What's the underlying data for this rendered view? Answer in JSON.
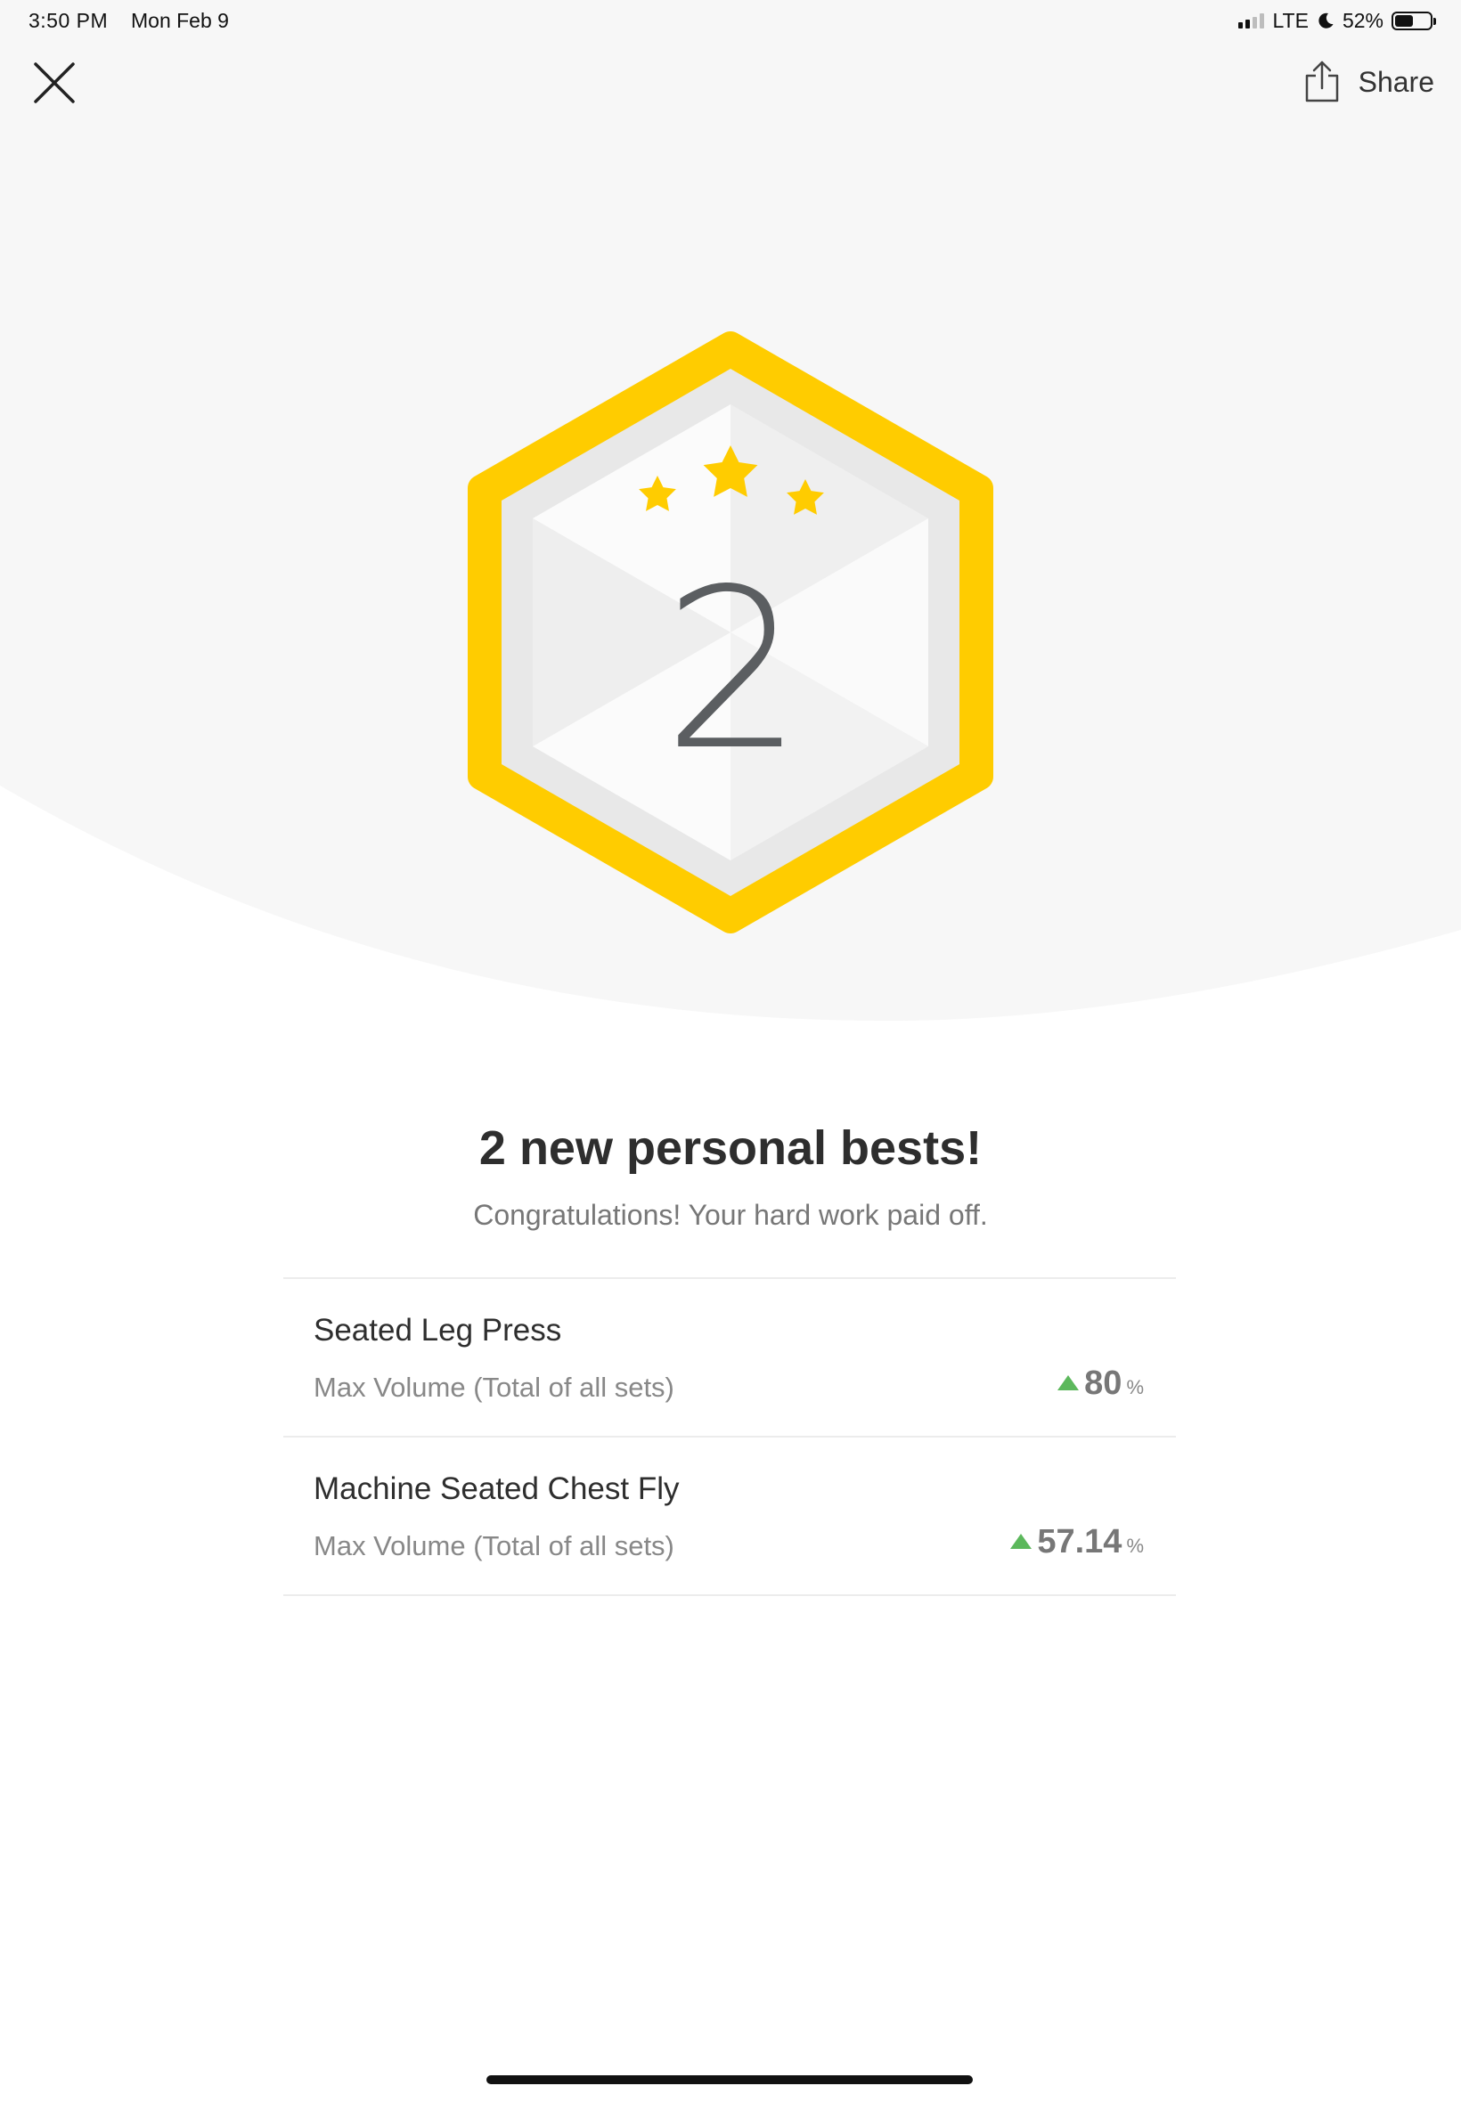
{
  "status_bar": {
    "time": "3:50 PM",
    "date": "Mon Feb 9",
    "network": "LTE",
    "battery_percent_label": "52%",
    "battery_level": 0.52,
    "signal_bars_active": 2
  },
  "header": {
    "close_icon": "close-icon",
    "share_icon": "share-icon",
    "share_label": "Share"
  },
  "badge": {
    "count": "2",
    "stars": 3,
    "ring_color": "#FFCC00",
    "star_color": "#FFCC00"
  },
  "main": {
    "title": "2 new personal bests!",
    "subtitle": "Congratulations! Your hard work paid off.",
    "records": [
      {
        "name": "Seated Leg Press",
        "metric": "Max Volume (Total of all sets)",
        "change": "80",
        "unit": "%"
      },
      {
        "name": "Machine Seated Chest Fly",
        "metric": "Max Volume (Total of all sets)",
        "change": "57.14",
        "unit": "%"
      }
    ]
  },
  "colors": {
    "accent": "#FFCC00",
    "positive": "#5CB85C",
    "hero_background": "#F7F7F7"
  }
}
